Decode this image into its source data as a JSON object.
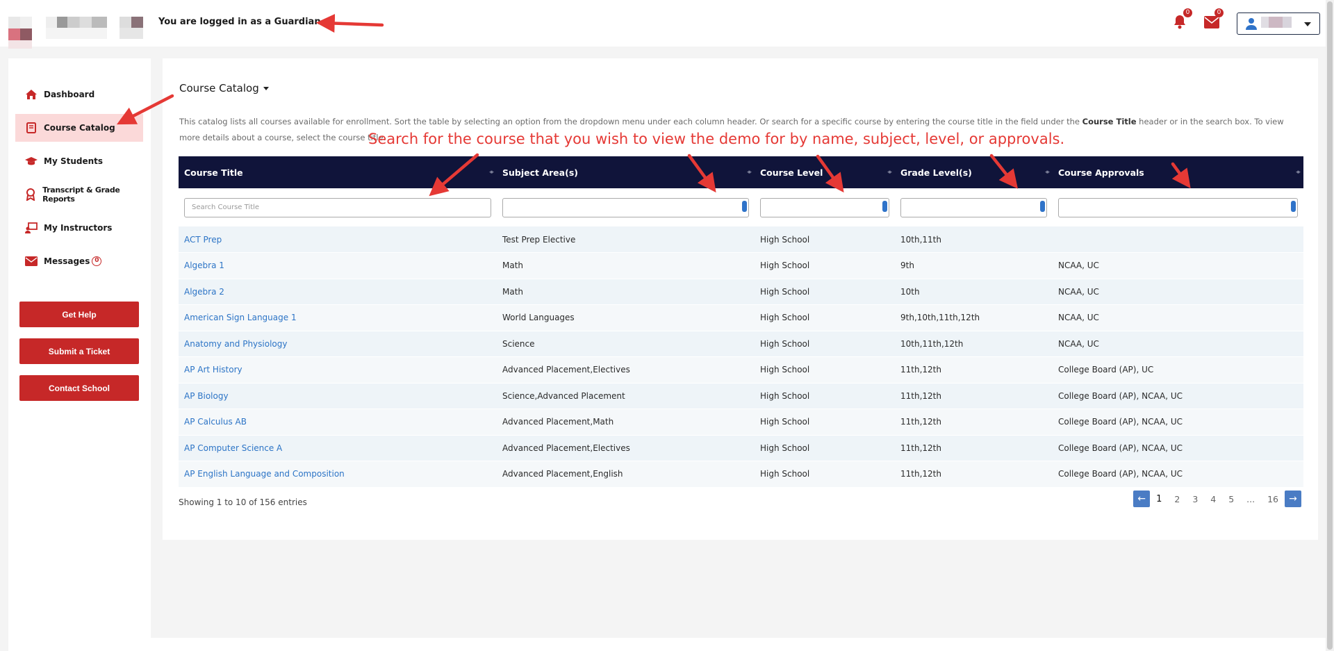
{
  "header": {
    "login_message": "You are logged in as a Guardian",
    "notifications_count": "0",
    "messages_count": "0"
  },
  "sidebar": {
    "items": [
      {
        "label": "Dashboard",
        "icon": "home-icon"
      },
      {
        "label": "Course Catalog",
        "icon": "book-icon",
        "active": true
      },
      {
        "label": "My Students",
        "icon": "graduation-cap-icon"
      },
      {
        "label": "Transcript & Grade Reports",
        "icon": "award-icon"
      },
      {
        "label": "My Instructors",
        "icon": "teacher-icon"
      },
      {
        "label": "Messages",
        "icon": "envelope-icon",
        "count": "0"
      }
    ],
    "buttons": [
      "Get Help",
      "Submit a Ticket",
      "Contact School"
    ]
  },
  "main": {
    "title": "Course Catalog",
    "intro_part1": "This catalog lists all courses available for enrollment. Sort the table by selecting an option from the dropdown menu under each column header. Or search for a specific course by entering the course title in the field under the ",
    "intro_bold": "Course Title",
    "intro_part2": " header or in the search box. To view more details about a course, select the course title.",
    "annotation": "Search for the course that you wish to view the demo for by name, subject, level, or approvals.",
    "search_placeholder": "Search Course Title",
    "columns": [
      "Course Title",
      "Subject Area(s)",
      "Course Level",
      "Grade Level(s)",
      "Course Approvals"
    ],
    "rows": [
      [
        "ACT Prep",
        "Test Prep Elective",
        "High School",
        "10th,11th",
        ""
      ],
      [
        "Algebra 1",
        "Math",
        "High School",
        "9th",
        "NCAA, UC"
      ],
      [
        "Algebra 2",
        "Math",
        "High School",
        "10th",
        "NCAA, UC"
      ],
      [
        "American Sign Language 1",
        "World Languages",
        "High School",
        "9th,10th,11th,12th",
        "NCAA, UC"
      ],
      [
        "Anatomy and Physiology",
        "Science",
        "High School",
        "10th,11th,12th",
        "NCAA, UC"
      ],
      [
        "AP Art History",
        "Advanced Placement,Electives",
        "High School",
        "11th,12th",
        "College Board (AP), UC"
      ],
      [
        "AP Biology",
        "Science,Advanced Placement",
        "High School",
        "11th,12th",
        "College Board (AP), NCAA, UC"
      ],
      [
        "AP Calculus AB",
        "Advanced Placement,Math",
        "High School",
        "11th,12th",
        "College Board (AP), NCAA, UC"
      ],
      [
        "AP Computer Science A",
        "Advanced Placement,Electives",
        "High School",
        "11th,12th",
        "College Board (AP), NCAA, UC"
      ],
      [
        "AP English Language and Composition",
        "Advanced Placement,English",
        "High School",
        "11th,12th",
        "College Board (AP), NCAA, UC"
      ]
    ],
    "showing": "Showing 1 to 10 of 156 entries",
    "pagination": [
      "1",
      "2",
      "3",
      "4",
      "5",
      "...",
      "16"
    ]
  },
  "colors": {
    "accent_red": "#c62828",
    "table_header": "#10143a",
    "link_blue": "#2c74c6",
    "annotation_red": "#e53935"
  }
}
